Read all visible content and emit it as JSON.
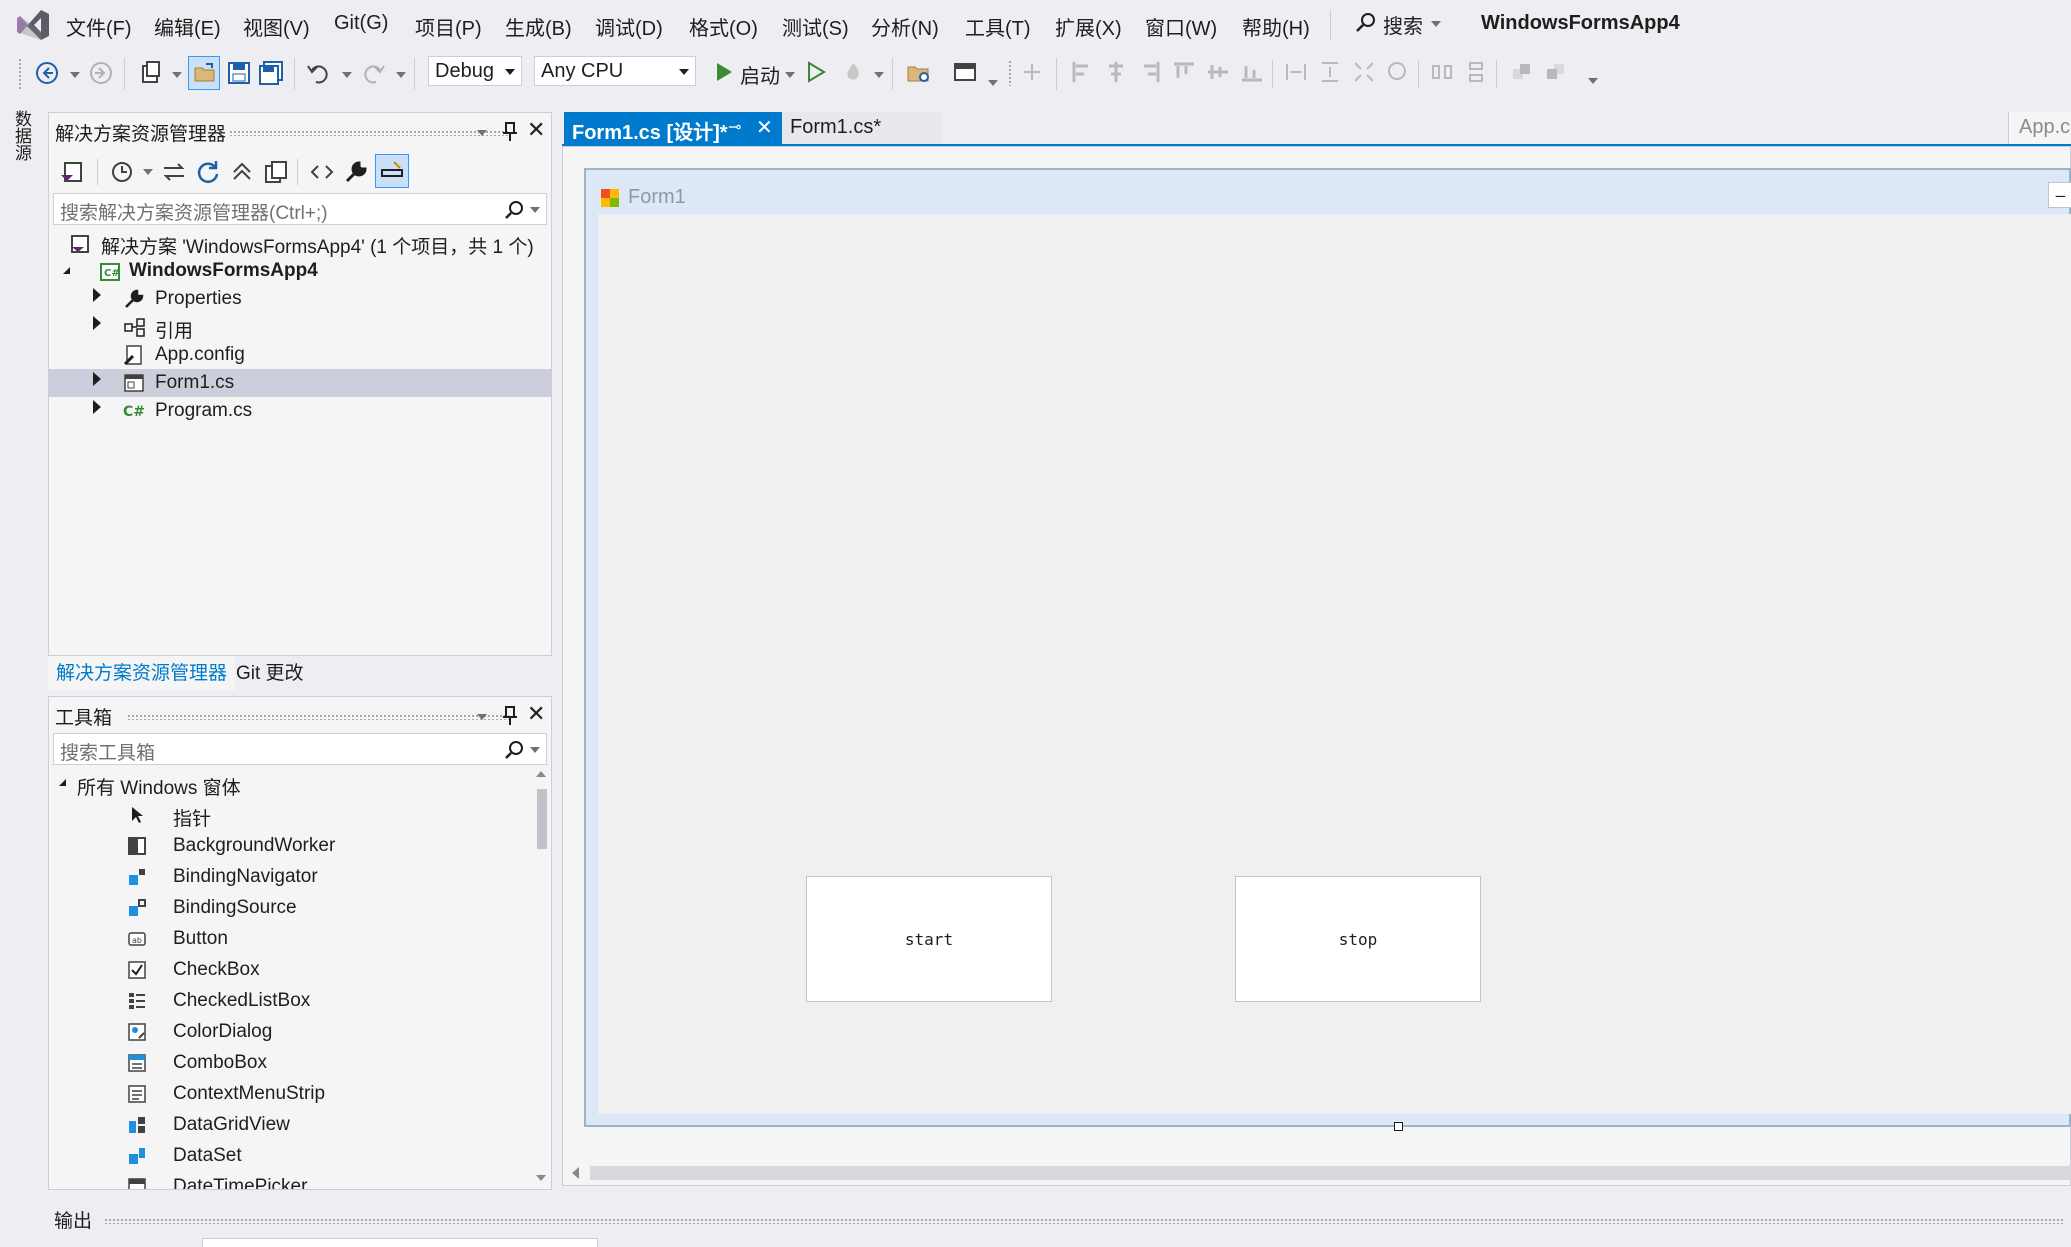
{
  "menubar": {
    "items": [
      "文件(F)",
      "编辑(E)",
      "视图(V)",
      "Git(G)",
      "项目(P)",
      "生成(B)",
      "调试(D)",
      "格式(O)",
      "测试(S)",
      "分析(N)",
      "工具(T)",
      "扩展(X)",
      "窗口(W)",
      "帮助(H)"
    ],
    "search_label": "搜索",
    "app_title": "WindowsFormsApp4"
  },
  "toolbar": {
    "config": "Debug",
    "platform": "Any CPU",
    "start_label": "启动"
  },
  "left_tab": {
    "label": "数据源"
  },
  "solution_explorer": {
    "title": "解决方案资源管理器",
    "search_placeholder": "搜索解决方案资源管理器(Ctrl+;)",
    "tree": [
      {
        "label": "解决方案 'WindowsFormsApp4' (1 个项目，共 1 个)",
        "icon": "solution-icon"
      },
      {
        "label": "WindowsFormsApp4",
        "icon": "csharp-project-icon"
      },
      {
        "label": "Properties",
        "icon": "wrench-icon"
      },
      {
        "label": "引用",
        "icon": "references-icon"
      },
      {
        "label": "App.config",
        "icon": "config-file-icon"
      },
      {
        "label": "Form1.cs",
        "icon": "form-file-icon"
      },
      {
        "label": "Program.cs",
        "icon": "csharp-file-icon"
      }
    ],
    "bottom_tabs": [
      "解决方案资源管理器",
      "Git 更改"
    ]
  },
  "toolbox": {
    "title": "工具箱",
    "search_placeholder": "搜索工具箱",
    "group": "所有 Windows 窗体",
    "items": [
      "指针",
      "BackgroundWorker",
      "BindingNavigator",
      "BindingSource",
      "Button",
      "CheckBox",
      "CheckedListBox",
      "ColorDialog",
      "ComboBox",
      "ContextMenuStrip",
      "DataGridView",
      "DataSet",
      "DateTimePicker"
    ]
  },
  "document": {
    "tabs": [
      "Form1.cs [设计]*",
      "Form1.cs*"
    ],
    "right_tab": "App.c"
  },
  "form": {
    "title": "Form1",
    "buttons": [
      "start",
      "stop"
    ]
  },
  "output": {
    "title": "输出"
  },
  "colors": {
    "accent": "#007acc",
    "tab_active": "#007acc",
    "selected_row": "#cccedb"
  }
}
